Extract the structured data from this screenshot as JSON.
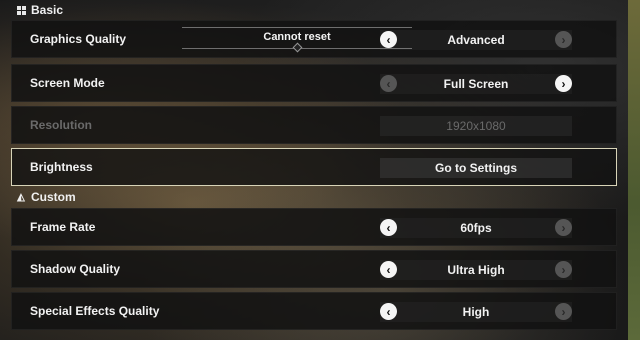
{
  "sections": {
    "basic": {
      "title": "Basic",
      "icon": "grid-icon"
    },
    "custom": {
      "title": "Custom",
      "icon": "triangle-ruler-icon"
    }
  },
  "tooltip": {
    "text": "Cannot reset"
  },
  "settings": {
    "graphics_quality": {
      "label": "Graphics Quality",
      "value": "Advanced",
      "left_arrow": "active",
      "right_arrow": "inactive"
    },
    "screen_mode": {
      "label": "Screen Mode",
      "value": "Full Screen",
      "left_arrow": "inactive",
      "right_arrow": "active"
    },
    "resolution": {
      "label": "Resolution",
      "value": "1920x1080",
      "disabled": true
    },
    "brightness": {
      "label": "Brightness",
      "button": "Go to Settings",
      "selected": true
    },
    "frame_rate": {
      "label": "Frame Rate",
      "value": "60fps",
      "left_arrow": "active",
      "right_arrow": "inactive"
    },
    "shadow_quality": {
      "label": "Shadow Quality",
      "value": "Ultra High",
      "left_arrow": "active",
      "right_arrow": "inactive"
    },
    "special_effects_quality": {
      "label": "Special Effects Quality",
      "value": "High",
      "left_arrow": "active",
      "right_arrow": "inactive"
    }
  },
  "icons": {
    "arrow_left": "‹",
    "arrow_right": "›",
    "custom_section": "◭"
  }
}
